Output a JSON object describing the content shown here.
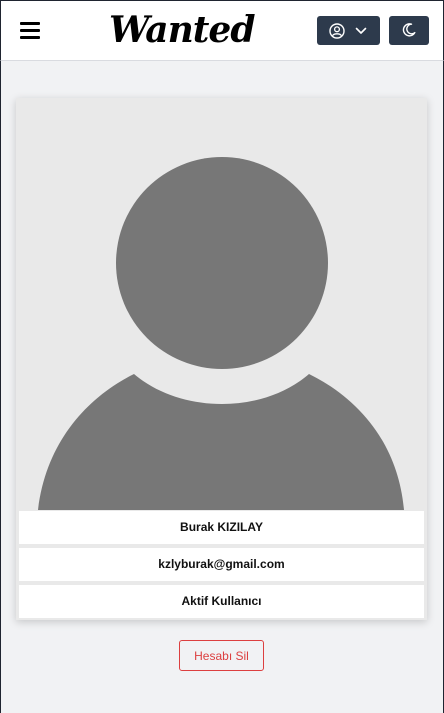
{
  "navbar": {
    "brand": "Wanted",
    "menu_icon": "hamburger-menu-icon",
    "user_icon": "user-circle-icon",
    "dropdown_icon": "chevron-down-icon",
    "theme_icon": "moon-icon",
    "button_color": "#2d3a4c"
  },
  "profile": {
    "avatar_icon": "default-user-avatar",
    "name": "Burak KIZILAY",
    "email": "kzlyburak@gmail.com",
    "status": "Aktif Kullanıcı"
  },
  "actions": {
    "delete_label": "Hesabı Sil",
    "delete_color": "#dc3f3f"
  },
  "colors": {
    "page_background": "#f1f2f4",
    "avatar_background": "#e9e9e9",
    "avatar_fill": "#777777"
  }
}
